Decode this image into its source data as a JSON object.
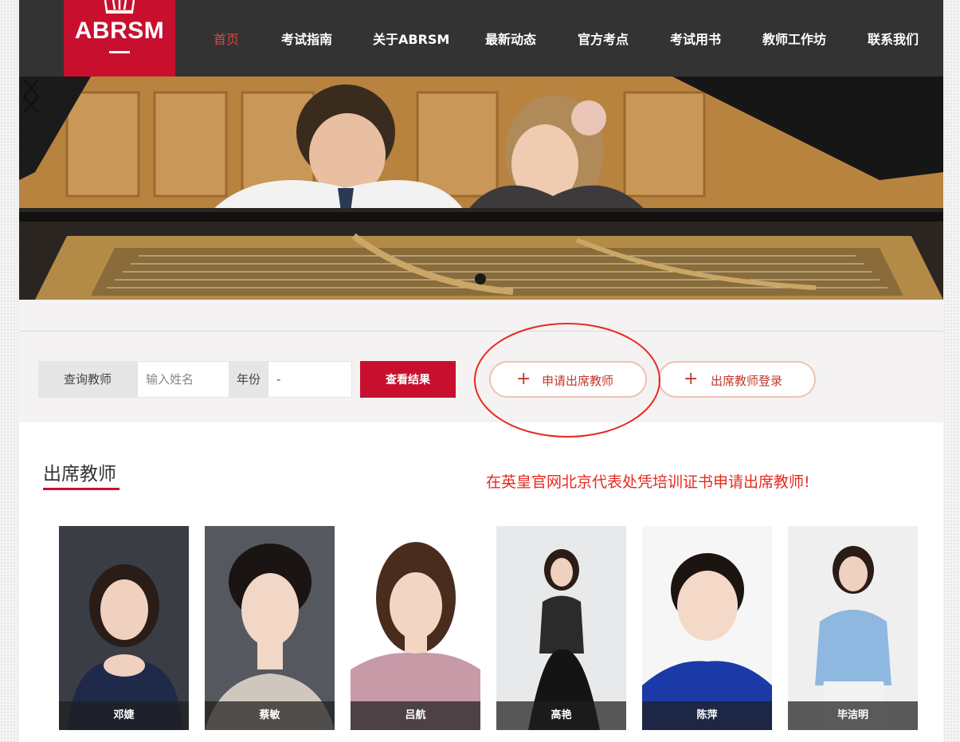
{
  "header": {
    "logo_text": "ABRSM",
    "nav": [
      {
        "label": "首页",
        "active": true
      },
      {
        "label": "考试指南"
      },
      {
        "label": "关于ABRSM"
      },
      {
        "label": "最新动态"
      },
      {
        "label": "官方考点"
      },
      {
        "label": "考试用书"
      },
      {
        "label": "教师工作坊"
      },
      {
        "label": "联系我们"
      }
    ]
  },
  "banner": {
    "prev_icon": "chevron-left-icon",
    "next_icon": "chevron-right-icon"
  },
  "search": {
    "teacher_label": "查询教师",
    "name_placeholder": "输入姓名",
    "year_label": "年份",
    "year_value": "-",
    "result_button": "查看结果",
    "apply_button": "申请出席教师",
    "login_button": "出席教师登录"
  },
  "teachers_section": {
    "title": "出席教师",
    "notice": "在英皇官网北京代表处凭培训证书申请出席教师!",
    "teachers": [
      {
        "name": "邓婕"
      },
      {
        "name": "蔡敏"
      },
      {
        "name": "吕航"
      },
      {
        "name": "高艳"
      },
      {
        "name": "陈萍"
      },
      {
        "name": "毕洁明"
      }
    ]
  },
  "colors": {
    "brand_red": "#c8102e",
    "header_bg": "#333333",
    "nav_active": "#e0443a",
    "notice_red": "#e8281f",
    "annotation_red": "#e8281f"
  }
}
